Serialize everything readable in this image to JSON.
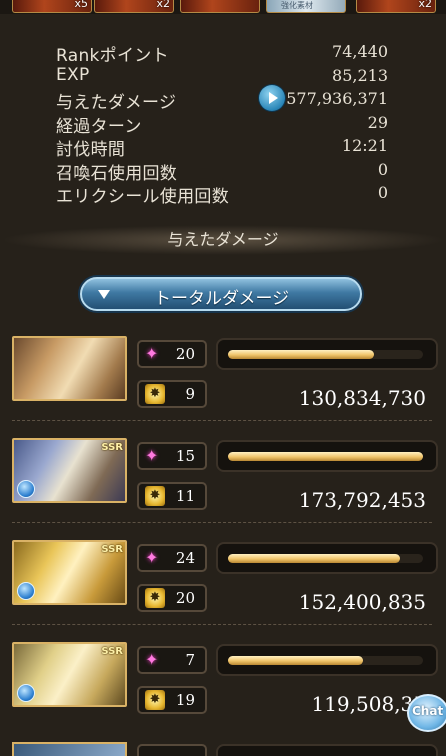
{
  "top_items": [
    {
      "qty": "x5"
    },
    {
      "qty": "x2"
    },
    {
      "qty": ""
    },
    {
      "label": "強化素材",
      "qty": ""
    },
    {
      "qty": "x2"
    }
  ],
  "stats": [
    {
      "label": "Rankポイント",
      "value": "74,440"
    },
    {
      "label": "EXP",
      "value": "85,213"
    },
    {
      "label": "与えたダメージ",
      "value": "577,936,371"
    },
    {
      "label": "経過ターン",
      "value": "29"
    },
    {
      "label": "討伐時間",
      "value": "12:21"
    },
    {
      "label": "召喚石使用回数",
      "value": "0"
    },
    {
      "label": "エリクシール使用回数",
      "value": "0"
    }
  ],
  "section_title": "与えたダメージ",
  "dropdown": {
    "label": "トータルダメージ"
  },
  "characters": [
    {
      "ougi": "20",
      "chain": "9",
      "damage": "130,834,730",
      "bar_fraction": 0.75,
      "ssr": ""
    },
    {
      "ougi": "15",
      "chain": "11",
      "damage": "173,792,453",
      "bar_fraction": 1.0,
      "ssr": "SSR"
    },
    {
      "ougi": "24",
      "chain": "20",
      "damage": "152,400,835",
      "bar_fraction": 0.88,
      "ssr": "SSR"
    },
    {
      "ougi": "7",
      "chain": "19",
      "damage": "119,508,35",
      "bar_fraction": 0.69,
      "ssr": "SSR"
    }
  ],
  "chat": {
    "label": "Chat"
  },
  "icons": {
    "ougi": "ougi-sparkle-icon",
    "chain": "chain-burst-icon",
    "element": "water-element-icon",
    "play": "play-icon"
  },
  "colors": {
    "bar_fill": "#f0c46a",
    "accent_blue": "#3f79a3",
    "background": "#26211a"
  }
}
